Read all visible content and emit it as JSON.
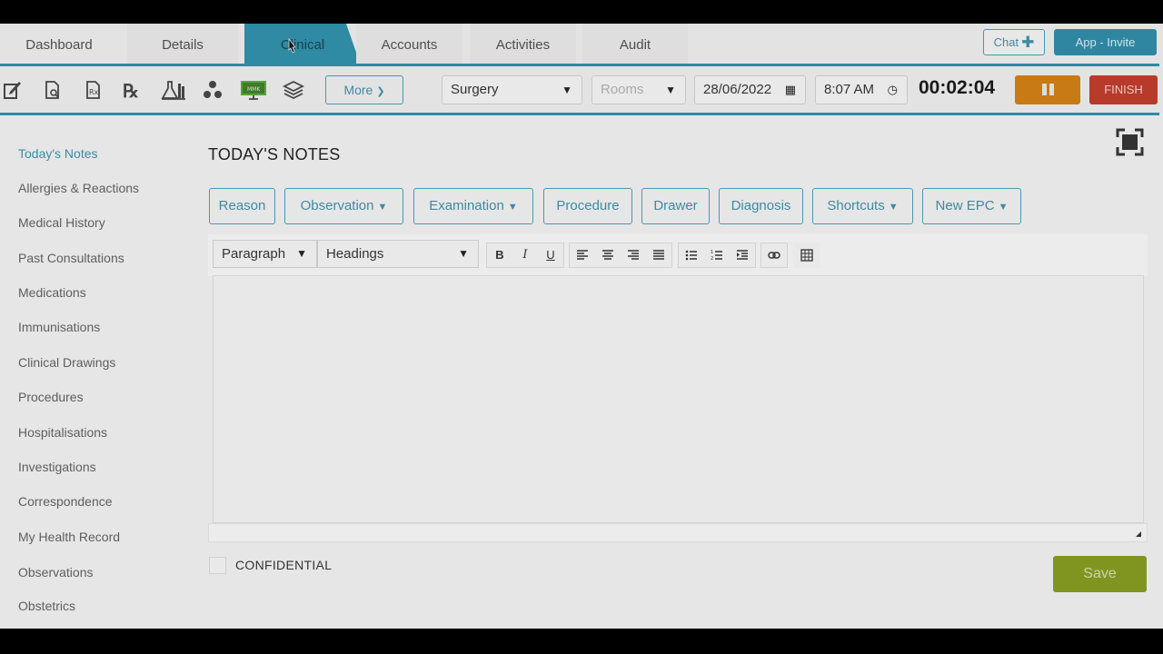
{
  "tabs": {
    "dashboard": "Dashboard",
    "details": "Details",
    "clinical": "Clinical",
    "accounts": "Accounts",
    "activities": "Activities",
    "audit": "Audit"
  },
  "header": {
    "chat_label": "Chat",
    "invite_label": "App - Invite"
  },
  "toolbar": {
    "icons": [
      "notes-icon",
      "document-icon",
      "script-icon",
      "prescription-icon",
      "lab-icon",
      "molecule-icon",
      "monitor-icon",
      "stack-icon"
    ],
    "more_label": "More",
    "location_value": "Surgery",
    "rooms_placeholder": "Rooms",
    "date_value": "28/06/2022",
    "time_value": "8:07 AM",
    "timer_value": "00:02:04",
    "finish_label": "FINISH"
  },
  "sidebar": {
    "items": [
      "Today's Notes",
      "Allergies & Reactions",
      "Medical History",
      "Past Consultations",
      "Medications",
      "Immunisations",
      "Clinical Drawings",
      "Procedures",
      "Hospitalisations",
      "Investigations",
      "Correspondence",
      "My Health Record",
      "Observations",
      "Obstetrics"
    ]
  },
  "main": {
    "title": "TODAY'S NOTES",
    "note_buttons": {
      "reason": "Reason",
      "observation": "Observation",
      "examination": "Examination",
      "procedure": "Procedure",
      "drawer": "Drawer",
      "diagnosis": "Diagnosis",
      "shortcuts": "Shortcuts",
      "new_epc": "New EPC"
    },
    "editor": {
      "block_format": "Paragraph",
      "headings": "Headings",
      "bold": "B",
      "italic": "I",
      "underline": "U"
    },
    "confidential_label": "CONFIDENTIAL",
    "save_label": "Save"
  },
  "colors": {
    "accent": "#2f8aa4",
    "pause": "#c87a14",
    "finish": "#b83a2a",
    "save": "#7f9520"
  }
}
